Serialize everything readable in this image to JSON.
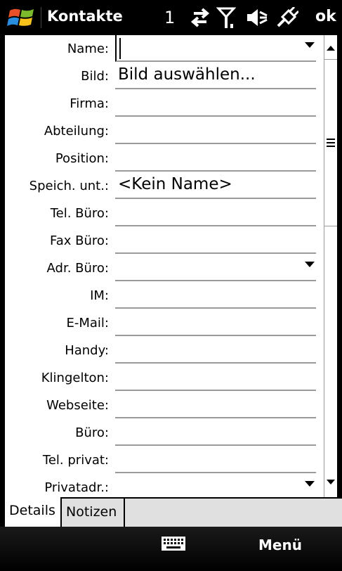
{
  "titlebar": {
    "app_title": "Kontakte",
    "status_number": "1",
    "ok_label": "ok",
    "icons": [
      "windows-start-icon",
      "data-connection-icon",
      "signal-strength-icon",
      "speaker-muted-icon",
      "battery-charging-icon"
    ]
  },
  "form": {
    "fields": [
      {
        "label": "Name:",
        "value": "",
        "dropdown": true
      },
      {
        "label": "Bild:",
        "value": "Bild auswählen..."
      },
      {
        "label": "Firma:",
        "value": ""
      },
      {
        "label": "Abteilung:",
        "value": ""
      },
      {
        "label": "Position:",
        "value": ""
      },
      {
        "label": "Speich. unt.:",
        "value": "<Kein Name>"
      },
      {
        "label": "Tel. Büro:",
        "value": ""
      },
      {
        "label": "Fax Büro:",
        "value": ""
      },
      {
        "label": "Adr. Büro:",
        "value": "",
        "dropdown": true
      },
      {
        "label": "IM:",
        "value": ""
      },
      {
        "label": "E-Mail:",
        "value": ""
      },
      {
        "label": "Handy:",
        "value": ""
      },
      {
        "label": "Klingelton:",
        "value": ""
      },
      {
        "label": "Webseite:",
        "value": ""
      },
      {
        "label": "Büro:",
        "value": ""
      },
      {
        "label": "Tel. privat:",
        "value": ""
      },
      {
        "label": "Privatadr.:",
        "value": "",
        "dropdown": true
      }
    ]
  },
  "tabs": [
    {
      "label": "Details",
      "active": true
    },
    {
      "label": "Notizen",
      "active": false
    }
  ],
  "menubar": {
    "menu_label": "Menü",
    "keyboard_icon": "keyboard-icon"
  },
  "colors": {
    "titlebar_bg": "#000000",
    "content_bg": "#ffffff",
    "field_line": "#9a9a9a",
    "tab_bg": "#e0e0e0"
  }
}
